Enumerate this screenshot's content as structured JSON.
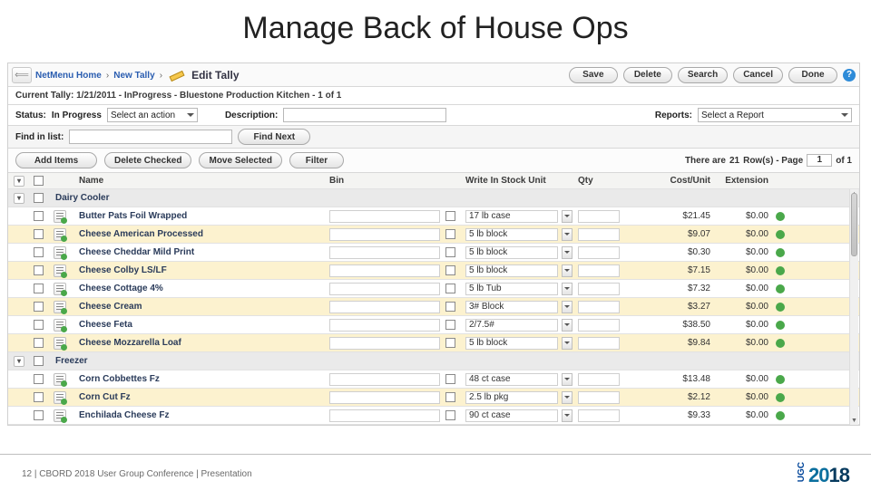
{
  "slide": {
    "title": "Manage Back of House Ops",
    "footer_left": "12 |  CBORD 2018 User Group Conference | Presentation",
    "logo_small": "UGC",
    "logo_year_a": "20",
    "logo_year_b": "18"
  },
  "breadcrumb": {
    "home": "NetMenu Home",
    "page": "New Tally",
    "current": "Edit Tally"
  },
  "top_buttons": {
    "save": "Save",
    "delete": "Delete",
    "search": "Search",
    "cancel": "Cancel",
    "done": "Done"
  },
  "info": {
    "label": "Current Tally:",
    "value": "1/21/2011 - InProgress - Bluestone Production Kitchen - 1 of 1"
  },
  "status_row": {
    "status_label": "Status:",
    "status_value": "In Progress",
    "action_select": "Select an action",
    "desc_label": "Description:",
    "desc_value": "",
    "reports_label": "Reports:",
    "reports_select": "Select a Report"
  },
  "find": {
    "label": "Find in list:",
    "value": "",
    "button": "Find Next"
  },
  "toolbar": {
    "add": "Add Items",
    "del": "Delete Checked",
    "move": "Move Selected",
    "filter": "Filter",
    "pager_a": "There are",
    "pager_rows": "21",
    "pager_b": "Row(s) - Page",
    "pager_page": "1",
    "pager_c": "of 1"
  },
  "columns": {
    "name": "Name",
    "bin": "Bin",
    "write": "Write In Stock Unit",
    "qty": "Qty",
    "cost": "Cost/Unit",
    "ext": "Extension"
  },
  "groups": [
    {
      "name": "Dairy Cooler"
    },
    {
      "name": "Freezer"
    }
  ],
  "rows_dairy": [
    {
      "name": "Butter Pats Foil Wrapped",
      "unit": "17 lb case",
      "cost": "$21.45",
      "ext": "$0.00"
    },
    {
      "name": "Cheese American Processed",
      "unit": "5 lb block",
      "cost": "$9.07",
      "ext": "$0.00"
    },
    {
      "name": "Cheese Cheddar Mild Print",
      "unit": "5 lb block",
      "cost": "$0.30",
      "ext": "$0.00"
    },
    {
      "name": "Cheese Colby LS/LF",
      "unit": "5 lb block",
      "cost": "$7.15",
      "ext": "$0.00"
    },
    {
      "name": "Cheese Cottage 4%",
      "unit": "5 lb Tub",
      "cost": "$7.32",
      "ext": "$0.00"
    },
    {
      "name": "Cheese Cream",
      "unit": "3# Block",
      "cost": "$3.27",
      "ext": "$0.00"
    },
    {
      "name": "Cheese Feta",
      "unit": "2/7.5#",
      "cost": "$38.50",
      "ext": "$0.00"
    },
    {
      "name": "Cheese Mozzarella Loaf",
      "unit": "5 lb block",
      "cost": "$9.84",
      "ext": "$0.00"
    }
  ],
  "rows_freezer": [
    {
      "name": "Corn Cobbettes Fz",
      "unit": "48 ct case",
      "cost": "$13.48",
      "ext": "$0.00"
    },
    {
      "name": "Corn Cut Fz",
      "unit": "2.5 lb pkg",
      "cost": "$2.12",
      "ext": "$0.00"
    },
    {
      "name": "Enchilada Cheese Fz",
      "unit": "90 ct case",
      "cost": "$9.33",
      "ext": "$0.00"
    }
  ]
}
